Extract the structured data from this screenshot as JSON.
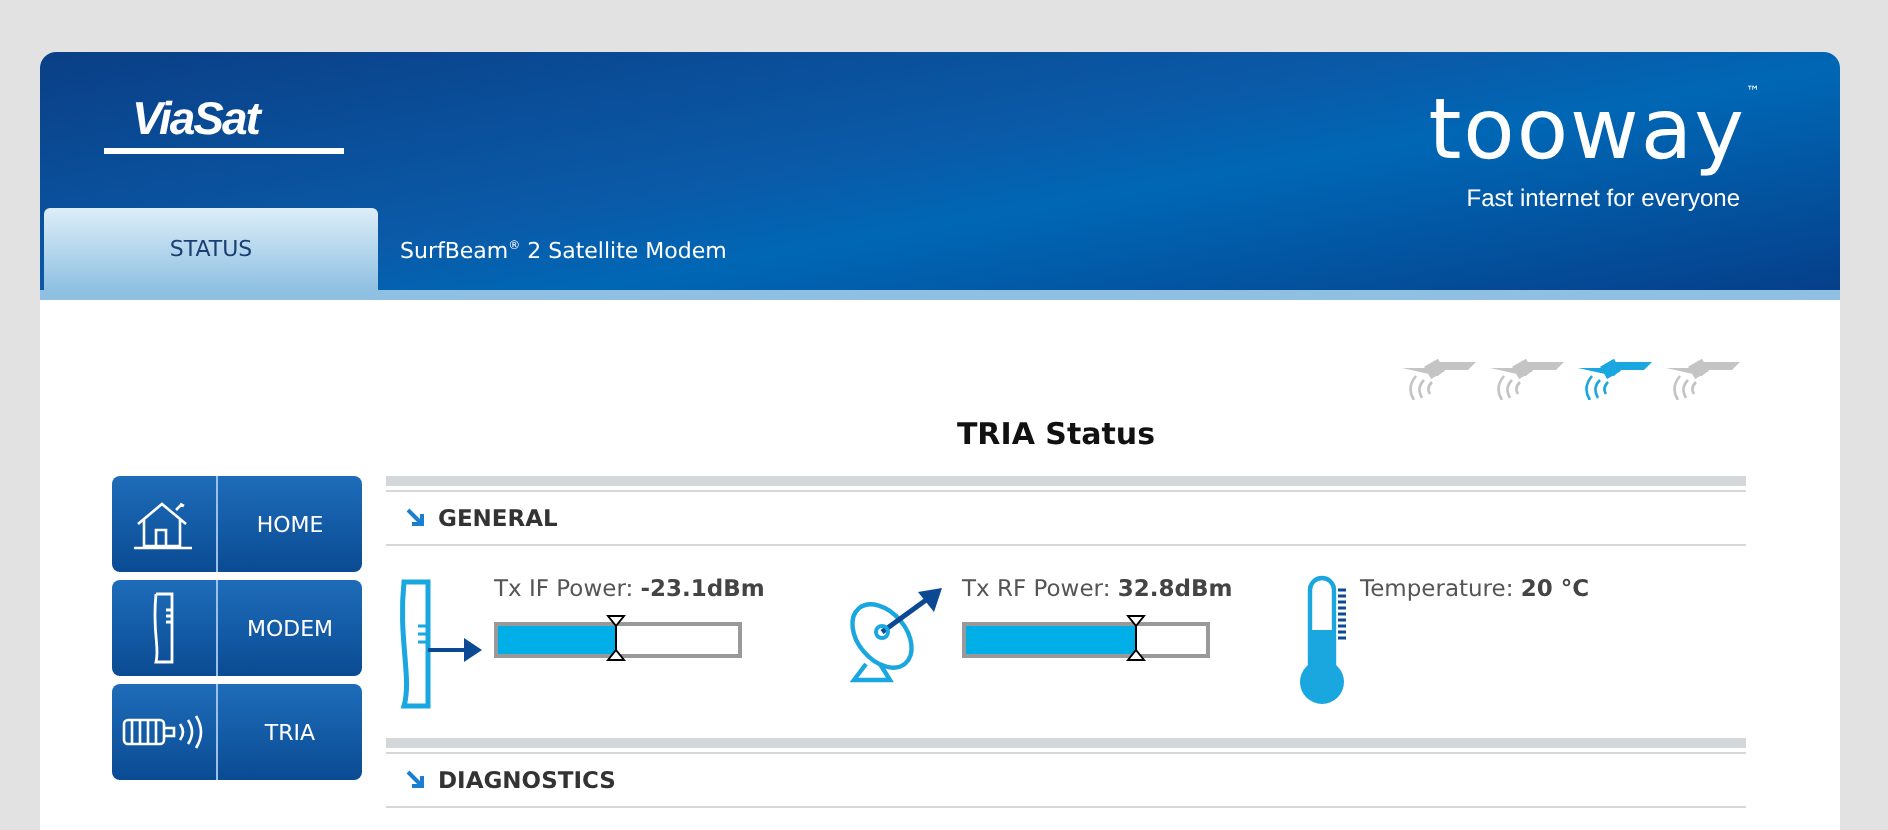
{
  "header": {
    "brand": "ViaSat",
    "tab": {
      "label": "STATUS",
      "selected": true
    },
    "subtitle": "SurfBeam$^{®}$ 2 Satellite Modem",
    "logo": "tooway",
    "trademark": "™",
    "tagline": "Fast internet for everyone"
  },
  "signal_steps": [
    {
      "active": false
    },
    {
      "active": false
    },
    {
      "active": true
    },
    {
      "active": false
    }
  ],
  "title": "TRIA Status",
  "nav": [
    {
      "kind": "home",
      "label": "HOME"
    },
    {
      "kind": "modem",
      "label": "MODEM"
    },
    {
      "kind": "tria",
      "label": "TRIA"
    }
  ],
  "sections": [
    {
      "title": "GENERAL",
      "metrics": [
        {
          "kind": "if",
          "label": "Tx IF Power:",
          "value": "-23.1dBm",
          "level": 0.49
        },
        {
          "kind": "rf",
          "label": "Tx RF Power:",
          "value": "32.8dBm",
          "level": 0.71
        },
        {
          "kind": "temp",
          "label": "Temperature:",
          "value": "20 °C"
        }
      ]
    },
    {
      "title": "DIAGNOSTICS"
    }
  ]
}
